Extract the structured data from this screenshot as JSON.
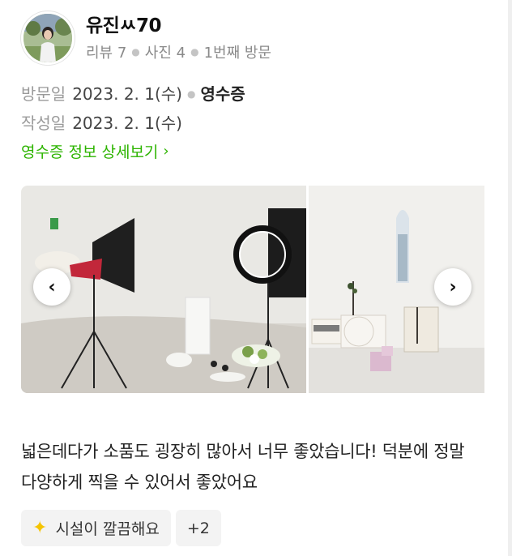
{
  "user": {
    "name": "유진ㅆ70",
    "reviews": "리뷰 7",
    "photos": "사진 4",
    "visit_count": "1번째 방문"
  },
  "visit": {
    "visit_label": "방문일",
    "visit_date": "2023. 2. 1(수)",
    "receipt_label": "영수증",
    "written_label": "작성일",
    "written_date": "2023. 2. 1(수)",
    "receipt_link": "영수증 정보 상세보기"
  },
  "gallery": {
    "prev_icon": "chevron-left-icon",
    "next_icon": "chevron-right-icon"
  },
  "review": {
    "text": "넓은데다가 소품도 굉장히 많아서 너무 좋았습니다! 덕분에 정말 다양하게 찍을 수 있어서 좋았어요"
  },
  "tags": {
    "items": [
      {
        "icon": "sparkles-icon",
        "label": "시설이 깔끔해요"
      },
      {
        "label": "+2"
      }
    ]
  },
  "colors": {
    "accent_green": "#2db400",
    "muted": "#9a9a9a"
  }
}
